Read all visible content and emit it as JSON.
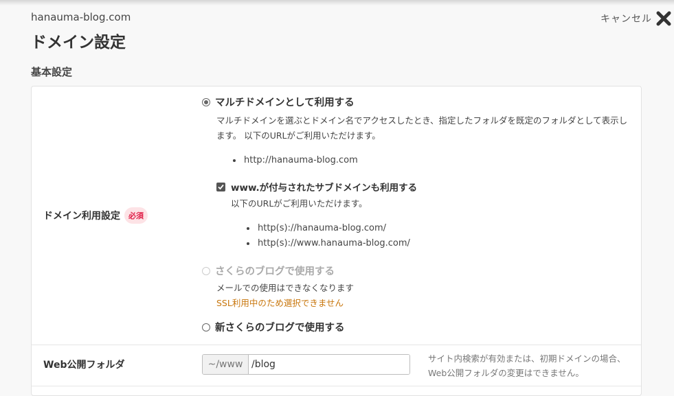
{
  "header": {
    "domain": "hanauma-blog.com",
    "title": "ドメイン設定",
    "cancel_label": "キャンセル"
  },
  "section": {
    "heading": "基本設定"
  },
  "domain_usage": {
    "label": "ドメイン利用設定",
    "required_badge": "必須",
    "options": [
      {
        "label": "マルチドメインとして利用する",
        "selected": true,
        "disabled": false,
        "description": "マルチドメインを選ぶとドメイン名でアクセスしたとき、指定したフォルダを既定のフォルダとして表示します。 以下のURLがご利用いただけます。",
        "urls": [
          "http://hanauma-blog.com"
        ]
      },
      {
        "label": "さくらのブログで使用する",
        "selected": false,
        "disabled": true,
        "description": "メールでの使用はできなくなります",
        "warning": "SSL利用中のため選択できません"
      },
      {
        "label": "新さくらのブログで使用する",
        "selected": false,
        "disabled": false
      }
    ],
    "www_option": {
      "label": "www.が付与されたサブドメインも利用する",
      "checked": true,
      "description": "以下のURLがご利用いただけます。",
      "urls": [
        "http(s)://hanauma-blog.com/",
        "http(s)://www.hanauma-blog.com/"
      ]
    }
  },
  "web_folder": {
    "label": "Web公開フォルダ",
    "prefix": "~/www",
    "value": "/blog",
    "note": "サイト内検索が有効または、初期ドメインの場合、Web公開フォルダの変更はできません。"
  },
  "colors": {
    "badge_bg": "#fde3e6",
    "badge_text": "#e0224a",
    "warning": "#c8760c"
  }
}
